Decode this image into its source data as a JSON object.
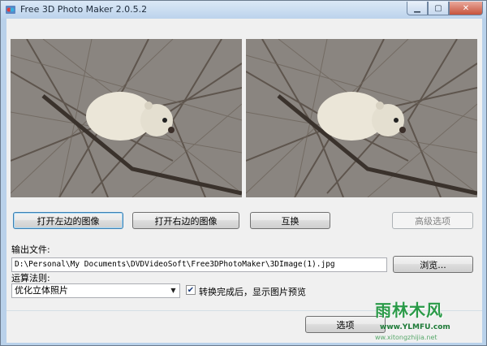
{
  "window": {
    "title": "Free 3D Photo Maker 2.0.5.2",
    "controls": {
      "minimize": "▁",
      "maximize": "▢",
      "close": "✕"
    }
  },
  "buttons": {
    "open_left": "打开左边的图像",
    "open_right": "打开右边的图像",
    "swap": "互换",
    "advanced": "高级选项",
    "browse": "浏览...",
    "options": "选项"
  },
  "output": {
    "label": "输出文件:",
    "path": "D:\\Personal\\My Documents\\DVDVideoSoft\\Free3DPhotoMaker\\3DImage(1).jpg"
  },
  "algorithm": {
    "label": "运算法则:",
    "selected": "优化立体照片"
  },
  "preview_checkbox": {
    "checked": true,
    "label": "转换完成后，显示图片预览"
  },
  "watermark": {
    "title": "雨林木风",
    "url": "www.YLMFU.com",
    "url2": "ww.xitongzhijia.net"
  },
  "colors": {
    "accent": "#3c7fb1",
    "window_frame": "#b9d1ea"
  }
}
